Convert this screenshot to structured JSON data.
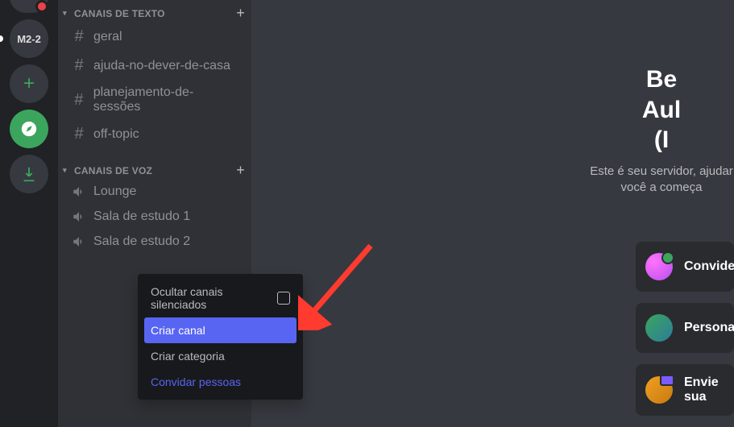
{
  "server_rail": {
    "m22_label": "M2-2"
  },
  "categories": {
    "text": {
      "label": "CANAIS DE TEXTO",
      "channels": [
        "geral",
        "ajuda-no-dever-de-casa",
        "planejamento-de-sessões",
        "off-topic"
      ]
    },
    "voice": {
      "label": "CANAIS DE VOZ",
      "channels": [
        "Lounge",
        "Sala de estudo 1",
        "Sala de estudo 2"
      ]
    }
  },
  "welcome": {
    "title": "Be\nAul\n(I",
    "subtitle": "Este é seu servidor,\najudar você a começa"
  },
  "cards": {
    "invite": "Convide",
    "personalize": "Personal",
    "send": "Envie sua"
  },
  "context_menu": {
    "mute": "Ocultar canais silenciados",
    "create_channel": "Criar canal",
    "create_category": "Criar categoria",
    "invite_people": "Convidar pessoas"
  }
}
